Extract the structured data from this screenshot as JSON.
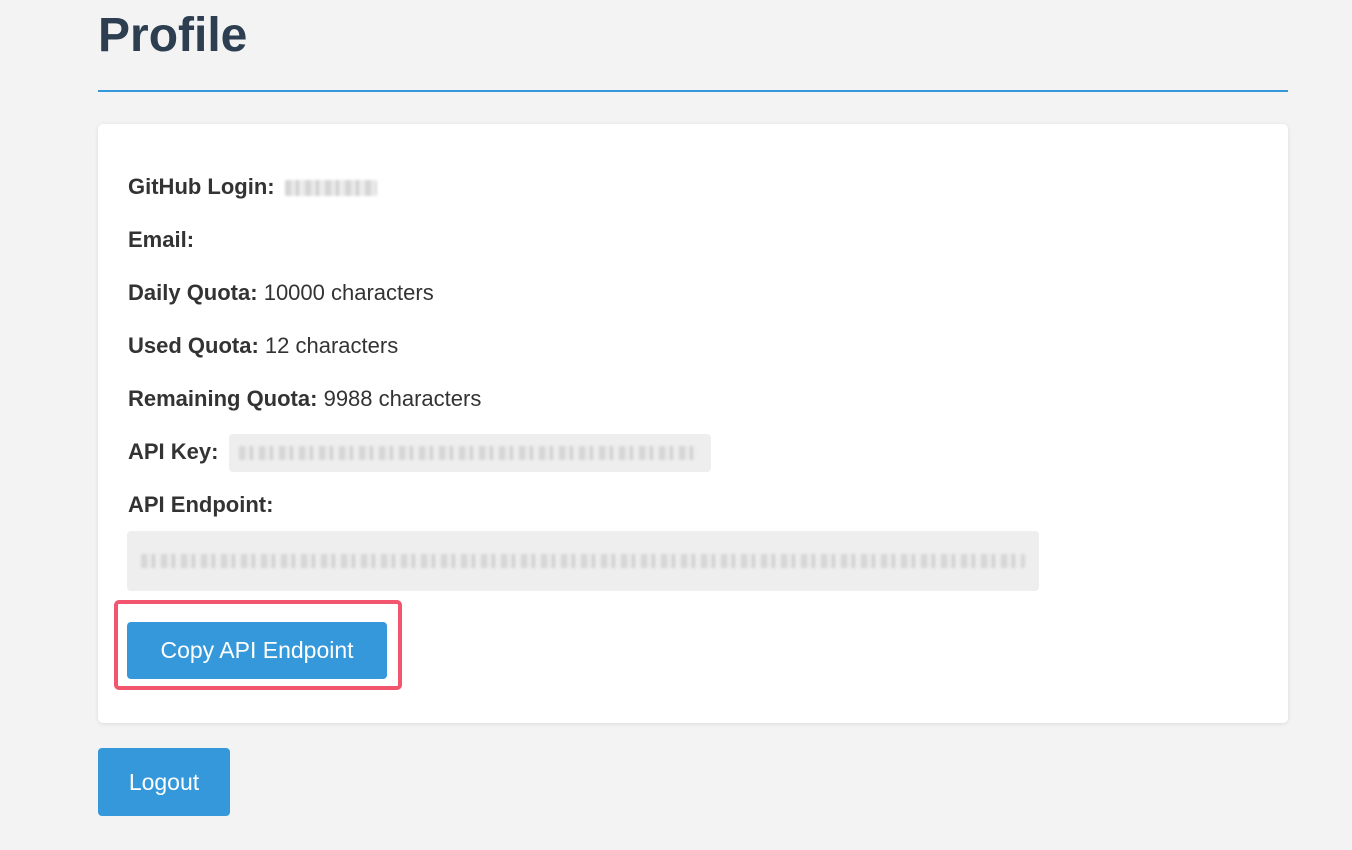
{
  "header": {
    "title": "Profile"
  },
  "profile": {
    "github_login_label": "GitHub Login:",
    "email_label": "Email:",
    "email_value": "",
    "daily_quota_label": "Daily Quota:",
    "daily_quota_value": "10000 characters",
    "used_quota_label": "Used Quota:",
    "used_quota_value": "12 characters",
    "remaining_quota_label": "Remaining Quota:",
    "remaining_quota_value": "9988 characters",
    "api_key_label": "API Key:",
    "api_endpoint_label": "API Endpoint:"
  },
  "actions": {
    "copy_endpoint_label": "Copy API Endpoint",
    "logout_label": "Logout"
  },
  "colors": {
    "accent": "#3498db",
    "title": "#2c3e50",
    "highlight": "#f2566e",
    "background": "#f3f3f3",
    "card": "#ffffff"
  }
}
